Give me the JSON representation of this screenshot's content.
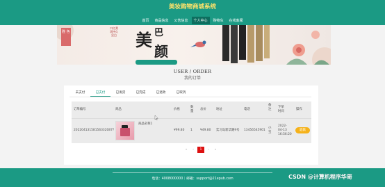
{
  "site": {
    "title": "美妆购物商城系统"
  },
  "nav": {
    "items": [
      {
        "label": "首页"
      },
      {
        "label": "商品信息"
      },
      {
        "label": "公告信息"
      },
      {
        "label": "个人中心"
      },
      {
        "label": "购物车"
      },
      {
        "label": "在线客服"
      }
    ],
    "active_index": 3
  },
  "banner": {
    "badge": "胜 色",
    "vertical_text": "口红柔润持久显白",
    "big_chars": [
      "美",
      "巴",
      "颜"
    ]
  },
  "page_heading": {
    "en": "USER / ORDER",
    "cn": "我的订单"
  },
  "tabs": {
    "items": [
      {
        "label": "未支付"
      },
      {
        "label": "已支付"
      },
      {
        "label": "已发货"
      },
      {
        "label": "已完成"
      },
      {
        "label": "已退款"
      },
      {
        "label": "已取消"
      }
    ],
    "active_index": 1
  },
  "table": {
    "headers": {
      "order_no": "订单编号",
      "product": "商品",
      "price": "价格",
      "quantity": "数量",
      "total": "总价",
      "address": "地址",
      "phone": "电话",
      "remark": "备注",
      "order_time": "下单时间",
      "action": "操作"
    },
    "rows": [
      {
        "order_no": "20220413158156332087?",
        "product_name": "商品名称1",
        "price": "¥99.80",
        "quantity": "1",
        "total": "¥49.80",
        "address": "实习岛新华路9号",
        "phone": "13456545901",
        "remark": "小宝",
        "order_time_date": "2022-",
        "order_time_md": "04-13",
        "order_time_clock": "16:56:20",
        "action_label": "退款"
      }
    ]
  },
  "pager": {
    "prev": "‹",
    "current": "1",
    "next": "›",
    "last": "»",
    "first": "«"
  },
  "footer": {
    "text": "电话：4008000000｜邮箱：support@21epub.com"
  },
  "watermark": "CSDN @计算机程序华哥",
  "colors": {
    "primary": "#1b9a84",
    "accent_yellow": "#ffe36a",
    "pay_button": "#f5b21a",
    "pager_active": "#dd1111"
  }
}
